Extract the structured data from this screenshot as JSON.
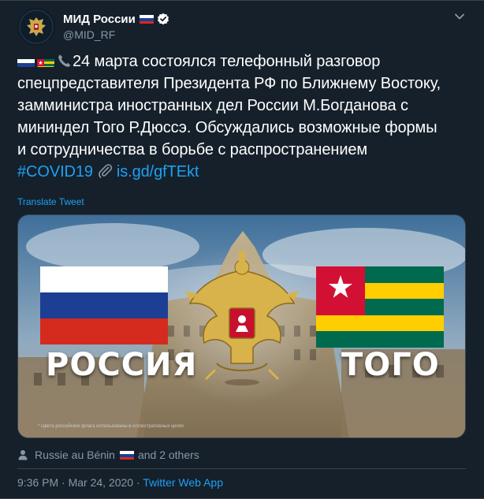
{
  "account": {
    "name": "МИД России",
    "handle": "@MID_RF"
  },
  "tweet": {
    "lines": [
      "24 марта состоялся телефонный разговор",
      "спецпредставителя Президента РФ по Ближнему Востоку,",
      "замминистра иностранных дел России М.Богданова с",
      "мининдел Того Р.Дюссэ. Обсуждались возможные формы",
      "и сотрудничества в борьбе с распространением"
    ],
    "hashtag": "#COVID19",
    "link": "is.gd/gfTEkt",
    "translate_label": "Translate Tweet"
  },
  "media": {
    "caption_left": "РОССИЯ",
    "caption_right": "ТОГО",
    "fine_print": "* Цвета российских флага использованы в иллюстративных целях"
  },
  "liked_by": {
    "name": "Russie au Bénin",
    "suffix": "and 2 others"
  },
  "meta": {
    "time": "9:36 PM",
    "separator": " · ",
    "date": "Mar 24, 2020",
    "app": "Twitter Web App"
  },
  "colors": {
    "background": "#15202b",
    "accent": "#1da1f2",
    "secondary_text": "#8899a6",
    "russia_white": "#ffffff",
    "russia_blue": "#1c3f94",
    "russia_red": "#d52b1e",
    "togo_green": "#006a4e",
    "togo_yellow": "#ffce00",
    "togo_red": "#d21034"
  },
  "icons": [
    "avatar-emblem-icon",
    "russia-flag-icon",
    "verified-badge-icon",
    "chevron-down-icon",
    "togo-flag-icon",
    "phone-icon",
    "paperclip-icon",
    "person-icon"
  ]
}
